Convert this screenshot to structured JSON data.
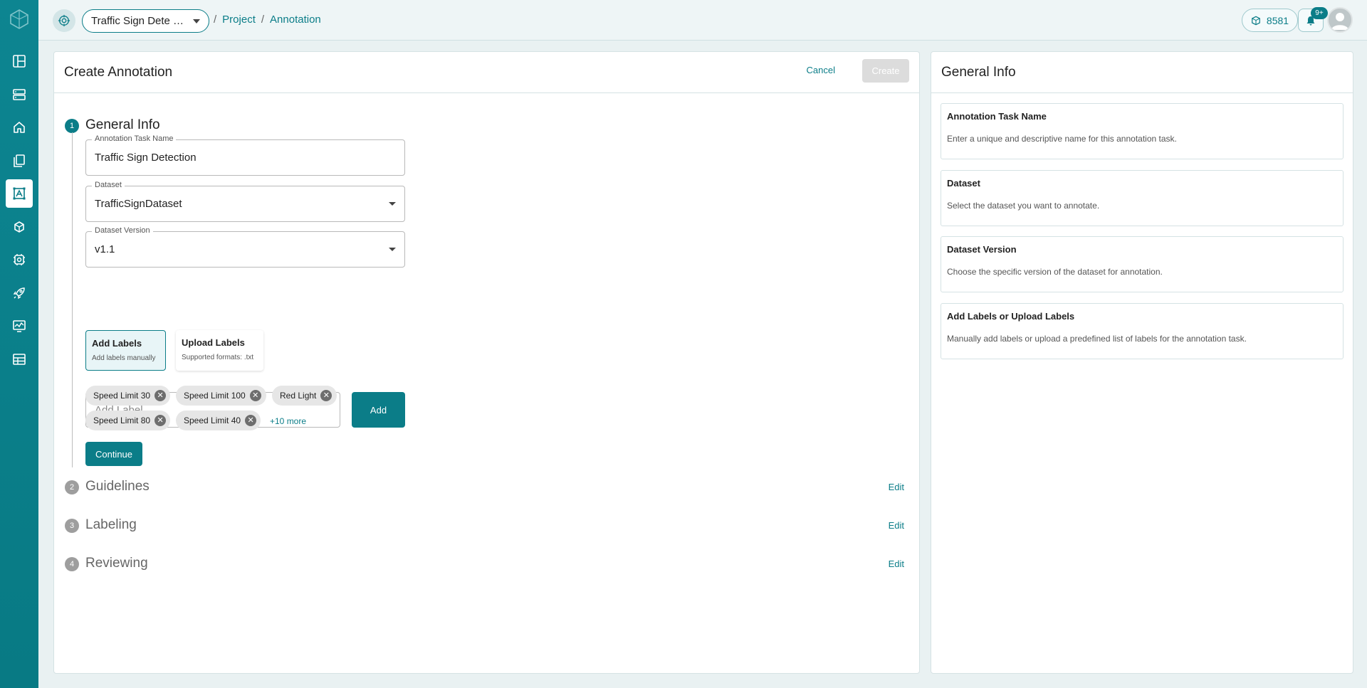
{
  "topbar": {
    "project_name": "Traffic Sign Dete …",
    "breadcrumbs": [
      "Project",
      "Annotation"
    ],
    "separator": "/",
    "credits": "8581",
    "notification_badge": "9+"
  },
  "sidebar": {
    "items": [
      {
        "icon": "layout-icon"
      },
      {
        "icon": "server-icon"
      },
      {
        "icon": "home-icon"
      },
      {
        "icon": "files-icon"
      },
      {
        "icon": "annotation-icon",
        "active": true
      },
      {
        "icon": "model-icon"
      },
      {
        "icon": "settings-icon"
      },
      {
        "icon": "rocket-icon"
      },
      {
        "icon": "monitor-icon"
      },
      {
        "icon": "table-icon"
      }
    ]
  },
  "main": {
    "title": "Create Annotation",
    "cancel_label": "Cancel",
    "create_label": "Create",
    "steps": [
      {
        "num": "1",
        "title": "General Info"
      },
      {
        "num": "2",
        "title": "Guidelines",
        "edit": "Edit"
      },
      {
        "num": "3",
        "title": "Labeling",
        "edit": "Edit"
      },
      {
        "num": "4",
        "title": "Reviewing",
        "edit": "Edit"
      }
    ],
    "fields": {
      "task_name": {
        "label": "Annotation Task Name",
        "value": "Traffic Sign Detection"
      },
      "dataset": {
        "label": "Dataset",
        "value": "TrafficSignDataset"
      },
      "dataset_version": {
        "label": "Dataset Version",
        "value": "v1.1"
      }
    },
    "label_modes": [
      {
        "title": "Add Labels",
        "subtitle": "Add labels manually",
        "selected": true
      },
      {
        "title": "Upload Labels",
        "subtitle": "Supported formats: .txt",
        "selected": false
      }
    ],
    "add_label_placeholder": "Add Label",
    "add_button": "Add",
    "labels": [
      "Speed Limit 30",
      "Speed Limit 100",
      "Red Light",
      "Speed Limit 80",
      "Speed Limit 40"
    ],
    "more_labels": "+10 more",
    "continue_label": "Continue"
  },
  "side": {
    "title": "General Info",
    "items": [
      {
        "title": "Annotation Task Name",
        "desc": "Enter a unique and descriptive name for this annotation task."
      },
      {
        "title": "Dataset",
        "desc": "Select the dataset you want to annotate."
      },
      {
        "title": "Dataset Version",
        "desc": "Choose the specific version of the dataset for annotation."
      },
      {
        "title": "Add Labels or Upload Labels",
        "desc": "Manually add labels or upload a predefined list of labels for the annotation task."
      }
    ]
  },
  "colors": {
    "accent": "#0b7d88",
    "sidebar": "#0d8591",
    "disabled": "#dcdcdc"
  }
}
